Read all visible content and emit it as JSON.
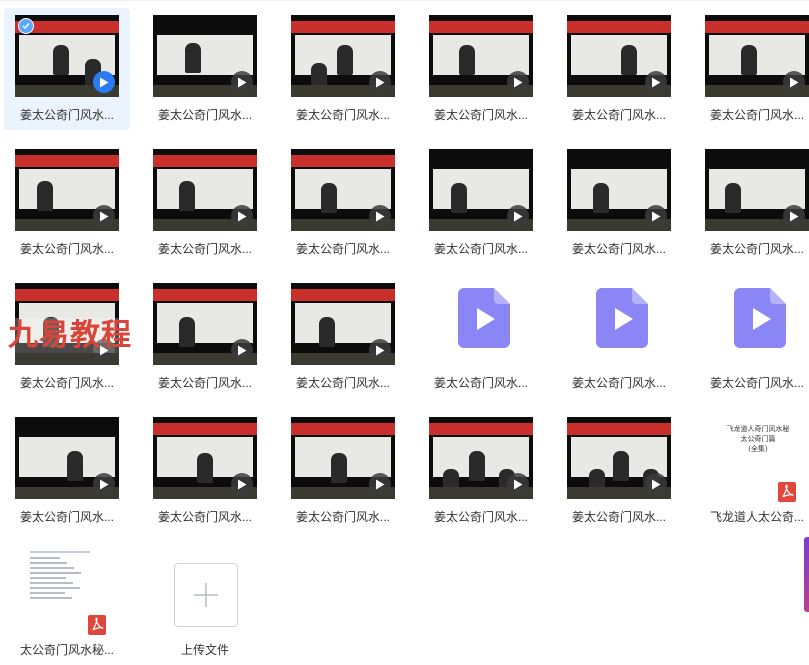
{
  "files": [
    {
      "label": "姜太公奇门风水...",
      "kind": "video-thumb",
      "selected": true
    },
    {
      "label": "姜太公奇门风水...",
      "kind": "video-thumb"
    },
    {
      "label": "姜太公奇门风水...",
      "kind": "video-thumb"
    },
    {
      "label": "姜太公奇门风水...",
      "kind": "video-thumb"
    },
    {
      "label": "姜太公奇门风水...",
      "kind": "video-thumb"
    },
    {
      "label": "姜太公奇门风水...",
      "kind": "video-thumb"
    },
    {
      "label": "姜太公奇门风水...",
      "kind": "video-thumb"
    },
    {
      "label": "姜太公奇门风水...",
      "kind": "video-thumb"
    },
    {
      "label": "姜太公奇门风水...",
      "kind": "video-thumb"
    },
    {
      "label": "姜太公奇门风水...",
      "kind": "video-thumb"
    },
    {
      "label": "姜太公奇门风水...",
      "kind": "video-thumb"
    },
    {
      "label": "姜太公奇门风水...",
      "kind": "video-thumb"
    },
    {
      "label": "姜太公奇门风水...",
      "kind": "video-thumb"
    },
    {
      "label": "姜太公奇门风水...",
      "kind": "video-thumb"
    },
    {
      "label": "姜太公奇门风水...",
      "kind": "video-thumb"
    },
    {
      "label": "姜太公奇门风水...",
      "kind": "video-icon"
    },
    {
      "label": "姜太公奇门风水...",
      "kind": "video-icon"
    },
    {
      "label": "姜太公奇门风水...",
      "kind": "video-icon"
    },
    {
      "label": "姜太公奇门风水...",
      "kind": "video-thumb"
    },
    {
      "label": "姜太公奇门风水...",
      "kind": "video-thumb"
    },
    {
      "label": "姜太公奇门风水...",
      "kind": "video-thumb"
    },
    {
      "label": "姜太公奇门风水...",
      "kind": "video-thumb"
    },
    {
      "label": "姜太公奇门风水...",
      "kind": "video-thumb"
    },
    {
      "label": "飞龙道人太公奇...",
      "kind": "pdf",
      "thumb_text": [
        "飞龙道人奇门风水秘",
        "太公奇门篇",
        "(全集)"
      ]
    },
    {
      "label": "太公奇门风水秘...",
      "kind": "pdf"
    },
    {
      "label": "上传文件",
      "kind": "upload"
    }
  ],
  "watermark": "九易教程",
  "colors": {
    "selected_bg": "#eaf3fe",
    "video_icon": "#8b86f6",
    "pdf_red": "#e2453c",
    "play_blue": "#2a7bf4"
  }
}
